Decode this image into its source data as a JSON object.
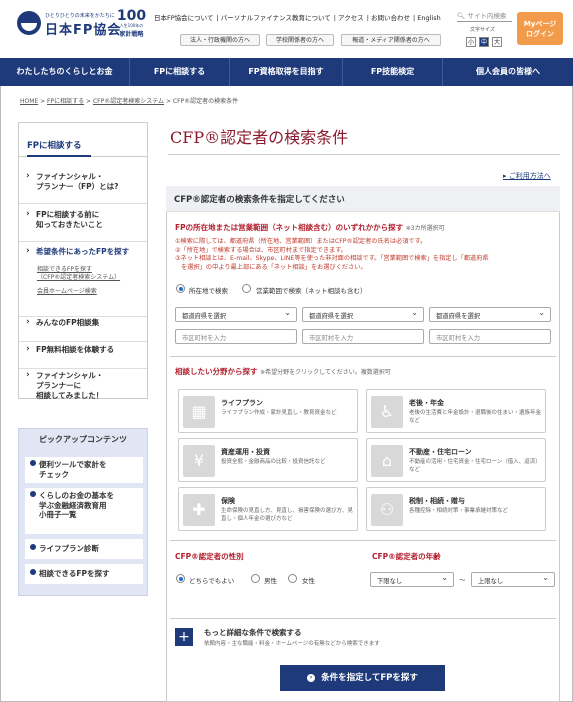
{
  "header": {
    "tagline": "ひとりひとりの未来をかたちに",
    "logo": "日本FP協会",
    "badge_num": "100",
    "badge_sub": "人生100年の",
    "badge_label": "家計戦略",
    "top_links": [
      "日本FP協会について",
      "パーソナルファイナンス教育について",
      "アクセス",
      "お問い合わせ",
      "English"
    ],
    "audience": [
      "法人・行政機関の方へ",
      "学校関係者の方へ",
      "報道・メディア関係者の方へ"
    ],
    "search_placeholder": "サイト内検索",
    "font_size_label": "文字サイズ",
    "font_sizes": [
      "小",
      "中",
      "大"
    ],
    "mypage": "Myページ\nログイン"
  },
  "gnav": [
    "わたしたちのくらしとお金",
    "FPに相談する",
    "FP資格取得を目指す",
    "FP技能検定",
    "個人会員の皆様へ"
  ],
  "breadcrumb": [
    "HOME",
    "FPに相談する",
    "CFP®認定者検索システム",
    "CFP®認定者の検索条件"
  ],
  "sidebar": {
    "head": "FPに相談する",
    "items": [
      "ファイナンシャル・\nプランナー（FP）とは?",
      "FPに相談する前に\n知っておきたいこと",
      "希望条件にあったFPを探す",
      "みんなのFP相談集",
      "FP無料相談を体験する",
      "ファイナンシャル・\nプランナーに\n相談してみました！"
    ],
    "subs": [
      "相談できるFPを探す\n（CFP®認定者検索システム）",
      "会員ホームページ検索"
    ]
  },
  "pickup": {
    "title": "ピックアップコンテンツ",
    "items": [
      "便利ツールで家計を\nチェック",
      "くらしのお金の基本を\n学ぶ金融経済教育用\n小冊子一覧",
      "ライフプラン診断",
      "相談できるFPを探す"
    ]
  },
  "page_title": "CFP®認定者の検索条件",
  "help_link": "ご利用方法へ",
  "panel_head": "CFP®認定者の検索条件を指定してください",
  "location": {
    "title": "FPの所在地または営業範囲（ネット相談含む）のいずれかから探す",
    "note": "※3カ所選択可",
    "notes": "①検索に際しては、都道府県（所在地、営業範囲）またはCFP®認定者の氏名は必須です。\n②「所在地」で検索する場合は、市区町村まで指定できます。\n③ネット相談とは、E-mail、Skype、LINE等を使った非対面の相談です。「営業範囲で検索」を指定し「都道府県\n　を選択」の中より最上部にある「ネット相談」をお選びください。",
    "radio1": "所在地で検索",
    "radio2": "営業範囲で検索（ネット相談も含む）",
    "select": "都道府県を選択",
    "input": "市区町村を入力"
  },
  "fields": {
    "title": "相談したい分野から探す",
    "note": "※希望分野をクリックしてください。複数選択可",
    "cards": [
      {
        "t": "ライフプラン",
        "d": "ライフプラン作成・家計見直し・教育資金など"
      },
      {
        "t": "老後・年金",
        "d": "老後の生活費と年金設計・退職後の住まい・遺族年金など"
      },
      {
        "t": "資産運用・投資",
        "d": "投資全般・金融商品の比較・投資信託など"
      },
      {
        "t": "不動産・住宅ローン",
        "d": "不動産の活用・住宅資金・住宅ローン（借入、返済）など"
      },
      {
        "t": "保険",
        "d": "生命保険の見直し方、見直し、損害保険の選び方、見直し・個人年金の選び方など"
      },
      {
        "t": "税制・相続・贈与",
        "d": "各種控除・相続対策・事業承継対策など"
      }
    ]
  },
  "gender": {
    "title": "CFP®認定者の性別",
    "options": [
      "どちらでもよい",
      "男性",
      "女性"
    ]
  },
  "age": {
    "title": "CFP®認定者の年齢",
    "from": "下限なし",
    "tilde": "〜",
    "to": "上限なし"
  },
  "more": {
    "title": "もっと詳細な条件で検索する",
    "desc": "依頼内容・主な職能・料金・ホームページの有無などから検索できます"
  },
  "submit": "条件を指定してFPを探す"
}
